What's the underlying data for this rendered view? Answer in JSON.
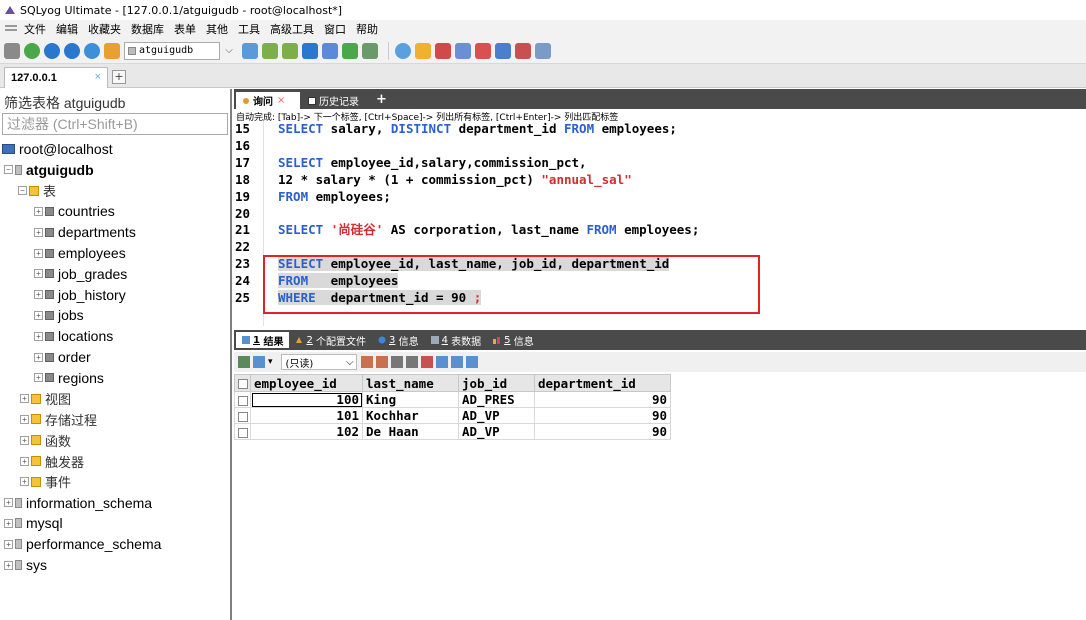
{
  "window": {
    "title": "SQLyog Ultimate - [127.0.0.1/atguigudb - root@localhost*]"
  },
  "menu": [
    "文件",
    "编辑",
    "收藏夹",
    "数据库",
    "表单",
    "其他",
    "工具",
    "高级工具",
    "窗口",
    "帮助"
  ],
  "toolbar": {
    "db_selector": "atguigudb"
  },
  "connection_tab": {
    "label": "127.0.0.1",
    "close": "×",
    "add": "+"
  },
  "sidebar": {
    "filter_label": "筛选表格 atguigudb",
    "filter_placeholder": "过滤器 (Ctrl+Shift+B)",
    "tree": [
      {
        "label": "root@localhost",
        "type": "host",
        "exp": ""
      },
      {
        "label": "atguigudb",
        "type": "db",
        "exp": "⊟"
      },
      {
        "label": "表",
        "type": "folder",
        "exp": "⊟"
      },
      {
        "label": "countries",
        "type": "table",
        "exp": "⊞"
      },
      {
        "label": "departments",
        "type": "table",
        "exp": "⊞"
      },
      {
        "label": "employees",
        "type": "table",
        "exp": "⊞"
      },
      {
        "label": "job_grades",
        "type": "table",
        "exp": "⊞"
      },
      {
        "label": "job_history",
        "type": "table",
        "exp": "⊞"
      },
      {
        "label": "jobs",
        "type": "table",
        "exp": "⊞"
      },
      {
        "label": "locations",
        "type": "table",
        "exp": "⊞"
      },
      {
        "label": "order",
        "type": "table",
        "exp": "⊞"
      },
      {
        "label": "regions",
        "type": "table",
        "exp": "⊞"
      },
      {
        "label": "视图",
        "type": "folder",
        "exp": "⊞"
      },
      {
        "label": "存储过程",
        "type": "folder",
        "exp": "⊞"
      },
      {
        "label": "函数",
        "type": "folder",
        "exp": "⊞"
      },
      {
        "label": "触发器",
        "type": "folder",
        "exp": "⊞"
      },
      {
        "label": "事件",
        "type": "folder",
        "exp": "⊞"
      },
      {
        "label": "information_schema",
        "type": "db",
        "exp": "⊞"
      },
      {
        "label": "mysql",
        "type": "db",
        "exp": "⊞"
      },
      {
        "label": "performance_schema",
        "type": "db",
        "exp": "⊞"
      },
      {
        "label": "sys",
        "type": "db",
        "exp": "⊞"
      }
    ]
  },
  "query_tabs": {
    "query": "询问",
    "history": "历史记录",
    "add": "+"
  },
  "autocomplete_hint": "自动完成: [Tab]-> 下一个标签, [Ctrl+Space]-> 列出所有标签, [Ctrl+Enter]-> 列出匹配标签",
  "editor": {
    "lines": [
      {
        "n": "15",
        "parts": [
          {
            "t": "SELECT",
            "c": "kw"
          },
          {
            "t": " salary, "
          },
          {
            "t": "DISTINCT",
            "c": "kw"
          },
          {
            "t": " department_id "
          },
          {
            "t": "FROM",
            "c": "kw"
          },
          {
            "t": " employees;"
          }
        ]
      },
      {
        "n": "16",
        "parts": []
      },
      {
        "n": "17",
        "parts": [
          {
            "t": "SELECT",
            "c": "kw"
          },
          {
            "t": " employee_id,salary,commission_pct,"
          }
        ]
      },
      {
        "n": "18",
        "parts": [
          {
            "t": "12 * salary * (1 + commission_pct) "
          },
          {
            "t": "\"annual_sal\"",
            "c": "str"
          }
        ]
      },
      {
        "n": "19",
        "parts": [
          {
            "t": "FROM",
            "c": "kw"
          },
          {
            "t": " employees;"
          }
        ]
      },
      {
        "n": "20",
        "parts": []
      },
      {
        "n": "21",
        "parts": [
          {
            "t": "SELECT",
            "c": "kw"
          },
          {
            "t": " "
          },
          {
            "t": "'尚硅谷'",
            "c": "str"
          },
          {
            "t": " AS corporation, last_name "
          },
          {
            "t": "FROM",
            "c": "kw"
          },
          {
            "t": " employees;"
          }
        ]
      },
      {
        "n": "22",
        "parts": []
      },
      {
        "n": "23",
        "parts": [
          {
            "t": "SELECT",
            "c": "kw"
          },
          {
            "t": " employee_id, last_name, job_id, department_id"
          }
        ],
        "sel": true
      },
      {
        "n": "24",
        "parts": [
          {
            "t": "FROM",
            "c": "kw"
          },
          {
            "t": "   employees"
          }
        ],
        "sel": true
      },
      {
        "n": "25",
        "parts": [
          {
            "t": "WHERE",
            "c": "kw"
          },
          {
            "t": "  department_id = 90 "
          },
          {
            "t": ";",
            "c": "str"
          }
        ],
        "sel": true
      }
    ]
  },
  "result_tabs": [
    {
      "num": "1",
      "label": "结果"
    },
    {
      "num": "2",
      "label": "个配置文件"
    },
    {
      "num": "3",
      "label": "信息"
    },
    {
      "num": "4",
      "label": "表数据"
    },
    {
      "num": "5",
      "label": "信息"
    }
  ],
  "result_toolbar": {
    "mode": "(只读)"
  },
  "grid": {
    "columns": [
      "employee_id",
      "last_name",
      "job_id",
      "department_id"
    ],
    "rows": [
      [
        "100",
        "King",
        "AD_PRES",
        "90"
      ],
      [
        "101",
        "Kochhar",
        "AD_VP",
        "90"
      ],
      [
        "102",
        "De Haan",
        "AD_VP",
        "90"
      ]
    ]
  }
}
